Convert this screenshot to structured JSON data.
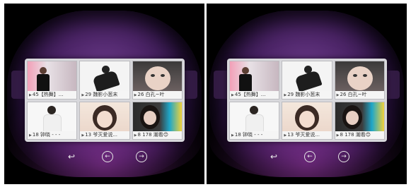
{
  "grid": {
    "tiles": [
      {
        "id": "t1",
        "caption": "45【热舞】..."
      },
      {
        "id": "t2",
        "caption": "29 魏影小葱末"
      },
      {
        "id": "t3",
        "caption": "26 白孔~叶"
      },
      {
        "id": "t4",
        "caption": "18 钟晓 - - -"
      },
      {
        "id": "t5",
        "caption": "13 爷灭爱说..."
      },
      {
        "id": "t6",
        "caption": "8 178 潮看😊"
      }
    ]
  },
  "icons": {
    "play": "▶",
    "back": "↩",
    "prev": "←",
    "next": "→"
  },
  "colors": {
    "lens_purple": "#4b2466",
    "panel_bg": "#d8d8dc"
  }
}
